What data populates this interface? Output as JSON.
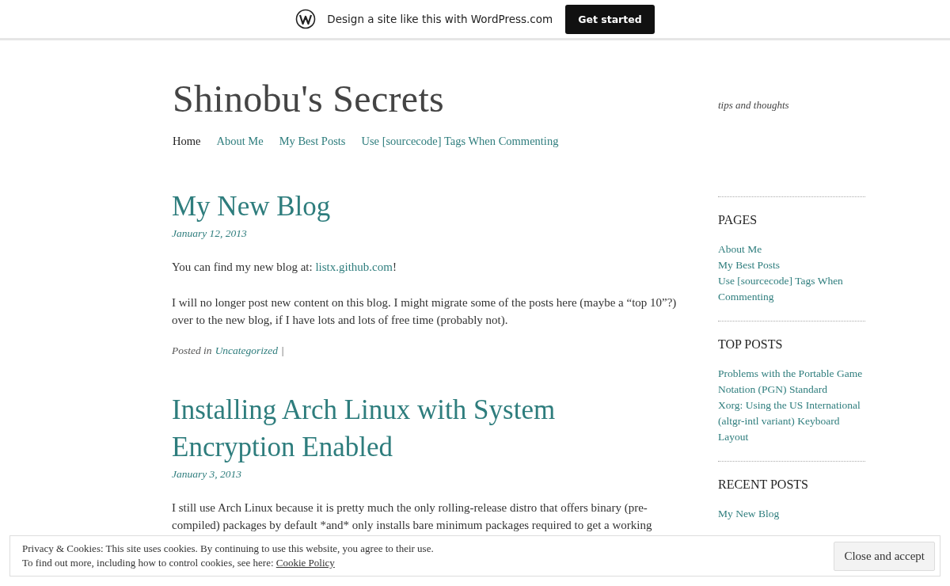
{
  "top_bar": {
    "text": "Design a site like this with WordPress.com",
    "button": "Get started"
  },
  "site": {
    "title": "Shinobu's Secrets",
    "tagline": "tips and thoughts"
  },
  "nav": [
    {
      "label": "Home",
      "selected": true
    },
    {
      "label": "About Me",
      "selected": false
    },
    {
      "label": "My Best Posts",
      "selected": false
    },
    {
      "label": "Use [sourcecode] Tags When Commenting",
      "selected": false
    }
  ],
  "posts": [
    {
      "title": "My New Blog",
      "date": "January 12, 2013",
      "paragraphs": [
        [
          {
            "text": "You can find my new blog at: ",
            "link": false
          },
          {
            "text": "listx.github.com",
            "link": true
          },
          {
            "text": "!",
            "link": false
          }
        ],
        [
          {
            "text": "I will no longer post new content on this blog. I might migrate some of the posts here (maybe a “top 10”?) over to the new blog, if I have lots and lots of free time (probably not).",
            "link": false
          }
        ]
      ],
      "footer": {
        "label": "Posted in",
        "category": "Uncategorized",
        "separator": "|"
      }
    },
    {
      "title": "Installing Arch Linux with System Encryption Enabled",
      "date": "January 3, 2013",
      "paragraphs": [
        [
          {
            "text": "I still use Arch Linux because it is pretty much the only rolling-release distro that offers binary (pre-compiled) packages by default *and* only installs bare minimum packages required to get a working",
            "link": false
          }
        ]
      ]
    }
  ],
  "sidebar": {
    "widgets": [
      {
        "title": "PAGES",
        "links": [
          "About Me",
          "My Best Posts",
          "Use [sourcecode] Tags When Commenting"
        ]
      },
      {
        "title": "TOP POSTS",
        "links": [
          "Problems with the Portable Game Notation (PGN) Standard",
          "Xorg: Using the US International (altgr-intl variant) Keyboard Layout"
        ]
      },
      {
        "title": "RECENT POSTS",
        "links": [
          "My New Blog"
        ]
      }
    ]
  },
  "cookie_banner": {
    "line_1": "Privacy & Cookies: This site uses cookies. By continuing to use this website, you agree to their use.",
    "line_2": "To find out more, including how to control cookies, see here: ",
    "policy_link": "Cookie Policy",
    "button": "Close and accept"
  }
}
